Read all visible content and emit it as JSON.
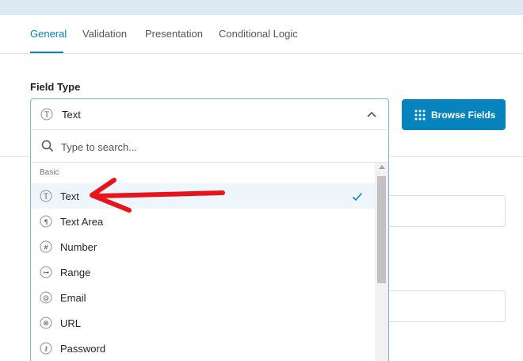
{
  "tabs": [
    {
      "label": "General",
      "active": true
    },
    {
      "label": "Validation",
      "active": false
    },
    {
      "label": "Presentation",
      "active": false
    },
    {
      "label": "Conditional Logic",
      "active": false
    }
  ],
  "field_type": {
    "label": "Field Type",
    "selected_value": "Text",
    "browse_button_label": "Browse Fields"
  },
  "dropdown": {
    "search_placeholder": "Type to search...",
    "group_label": "Basic",
    "options": [
      {
        "label": "Text",
        "icon": "text-icon",
        "glyph": "T",
        "selected": true
      },
      {
        "label": "Text Area",
        "icon": "textarea-icon",
        "glyph": "¶",
        "selected": false
      },
      {
        "label": "Number",
        "icon": "number-icon",
        "glyph": "#",
        "selected": false
      },
      {
        "label": "Range",
        "icon": "range-icon",
        "glyph": "⊶",
        "selected": false
      },
      {
        "label": "Email",
        "icon": "email-icon",
        "glyph": "@",
        "selected": false
      },
      {
        "label": "URL",
        "icon": "globe-icon",
        "glyph": "⊕",
        "selected": false
      },
      {
        "label": "Password",
        "icon": "key-icon",
        "glyph": "⚷",
        "selected": false
      }
    ]
  },
  "colors": {
    "accent": "#0783be",
    "annotation_arrow": "#e8141b",
    "selected_row": "#eef6fb"
  }
}
